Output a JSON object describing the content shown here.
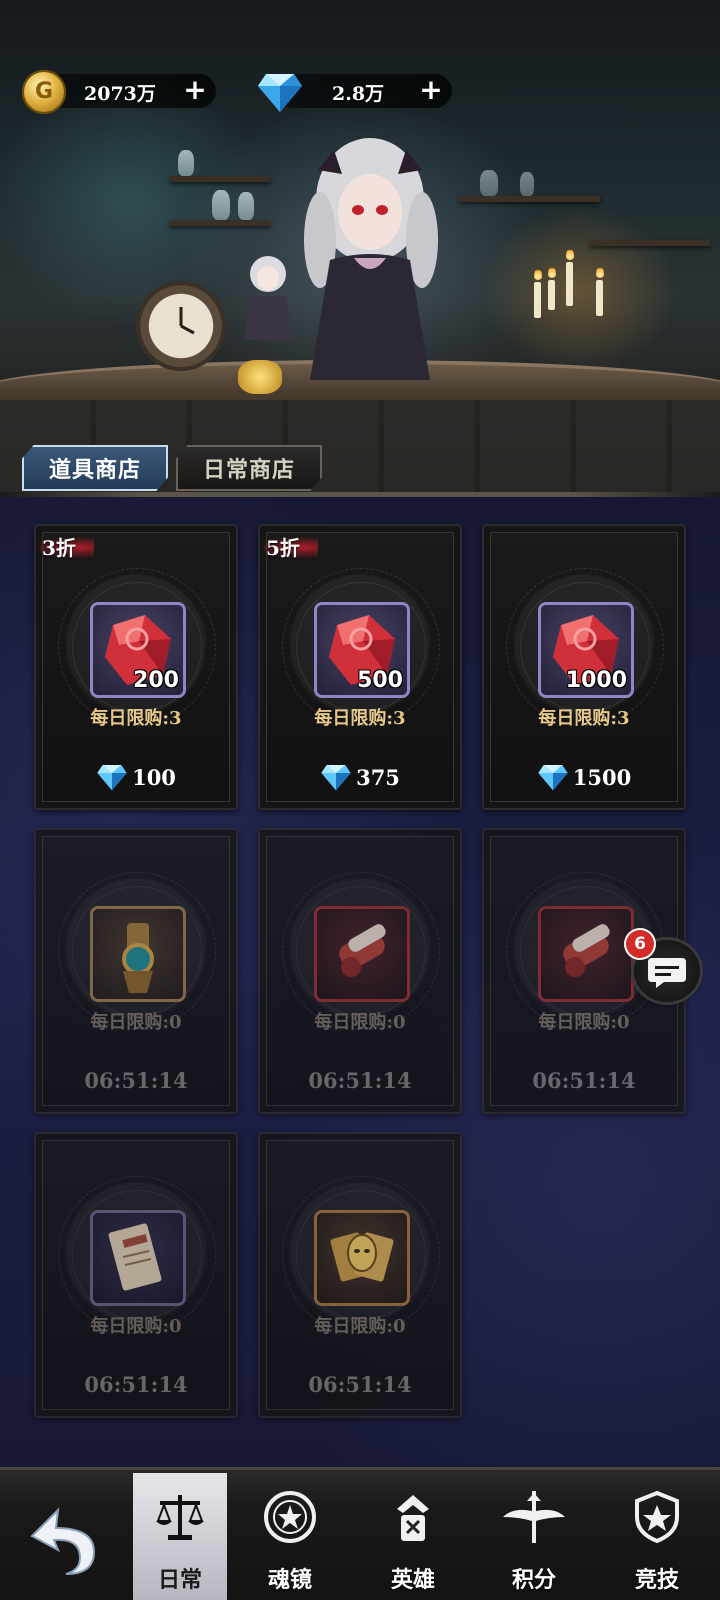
{
  "currency": {
    "gold_value": "2073万",
    "gem_value": "2.8万",
    "gold_icon": "gold-coin-icon",
    "gem_icon": "blue-diamond-icon",
    "plus_label": "+"
  },
  "tabs": [
    {
      "label": "道具商店",
      "active": true
    },
    {
      "label": "日常商店",
      "active": false
    }
  ],
  "shop_items": [
    {
      "discount": "3折",
      "item": "red-crystal-icon",
      "qty": "200",
      "limit": "每日限购:3",
      "price": "100",
      "currency_icon": "blue-diamond-icon"
    },
    {
      "discount": "5折",
      "item": "red-crystal-icon",
      "qty": "500",
      "limit": "每日限购:3",
      "price": "375",
      "currency_icon": "blue-diamond-icon"
    },
    {
      "discount": "",
      "item": "red-crystal-icon",
      "qty": "1000",
      "limit": "每日限购:3",
      "price": "1500",
      "currency_icon": "blue-diamond-icon"
    },
    {
      "item": "gold-scroll-key-icon",
      "limit": "每日限购:0",
      "timer": "06:51:14"
    },
    {
      "item": "red-scroll-icon",
      "limit": "每日限购:0",
      "timer": "06:51:14"
    },
    {
      "item": "red-scroll-icon",
      "limit": "每日限购:0",
      "timer": "06:51:14"
    },
    {
      "item": "ticket-card-icon",
      "limit": "每日限购:0",
      "timer": "06:51:14"
    },
    {
      "item": "gold-mask-cards-icon",
      "limit": "每日限购:0",
      "timer": "06:51:14"
    }
  ],
  "chat": {
    "badge_count": "6",
    "icon": "chat-bubble-icon"
  },
  "nav": {
    "back_icon": "back-arrow-icon",
    "items": [
      {
        "label": "日常",
        "icon": "scales-icon",
        "active": true
      },
      {
        "label": "魂镜",
        "icon": "star-mirror-icon",
        "active": false
      },
      {
        "label": "英雄",
        "icon": "hero-icon",
        "active": false
      },
      {
        "label": "积分",
        "icon": "winged-sword-icon",
        "active": false
      },
      {
        "label": "竞技",
        "icon": "shield-icon",
        "active": false
      }
    ]
  },
  "colors": {
    "gold_text": "#e6c98a",
    "accent_blue": "#8fb0d0",
    "badge_red": "#d42a2a"
  }
}
